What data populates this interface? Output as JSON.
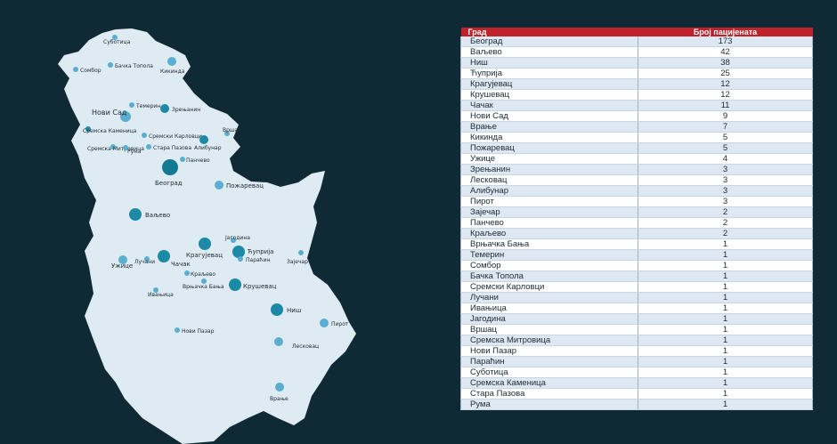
{
  "table": {
    "headers": {
      "city": "Град",
      "count": "Број пацијената"
    },
    "rows": [
      {
        "city": "Београд",
        "count": "173"
      },
      {
        "city": "Ваљево",
        "count": "42"
      },
      {
        "city": "Ниш",
        "count": "38"
      },
      {
        "city": "Ћуприја",
        "count": "25"
      },
      {
        "city": "Крагујевац",
        "count": "12"
      },
      {
        "city": "Крушевац",
        "count": "12"
      },
      {
        "city": "Чачак",
        "count": "11"
      },
      {
        "city": "Нови Сад",
        "count": "9"
      },
      {
        "city": "Врање",
        "count": "7"
      },
      {
        "city": "Кикинда",
        "count": "5"
      },
      {
        "city": "Пожаревац",
        "count": "5"
      },
      {
        "city": "Ужице",
        "count": "4"
      },
      {
        "city": "Зрењанин",
        "count": "3"
      },
      {
        "city": "Лесковац",
        "count": "3"
      },
      {
        "city": "Алибунар",
        "count": "3"
      },
      {
        "city": "Пирот",
        "count": "3"
      },
      {
        "city": "Зајечар",
        "count": "2"
      },
      {
        "city": "Панчево",
        "count": "2"
      },
      {
        "city": "Краљево",
        "count": "2"
      },
      {
        "city": "Врњачка Бања",
        "count": "1"
      },
      {
        "city": "Темерин",
        "count": "1"
      },
      {
        "city": "Сомбор",
        "count": "1"
      },
      {
        "city": "Бачка Топола",
        "count": "1"
      },
      {
        "city": "Сремски Карловци",
        "count": "1"
      },
      {
        "city": "Лучани",
        "count": "1"
      },
      {
        "city": "Ивањица",
        "count": "1"
      },
      {
        "city": "Јагодина",
        "count": "1"
      },
      {
        "city": "Вршац",
        "count": "1"
      },
      {
        "city": "Сремска Митровица",
        "count": "1"
      },
      {
        "city": "Нови Пазар",
        "count": "1"
      },
      {
        "city": "Параћин",
        "count": "1"
      },
      {
        "city": "Суботица",
        "count": "1"
      },
      {
        "city": "Сремска Каменица",
        "count": "1"
      },
      {
        "city": "Стара Пазова",
        "count": "1"
      },
      {
        "city": "Рума",
        "count": "1"
      }
    ]
  },
  "map": {
    "labels": {
      "subotica": "Суботица",
      "sombor": "Сомбор",
      "backa_topola": "Бачка Топола",
      "kikinda": "Кикинда",
      "temerin": "Темерин",
      "novi_sad": "Нови Сад",
      "zrenjanin": "Зрењанин",
      "sremska_kamenica": "Сремска Каменица",
      "sremski_karlovci": "Сремски Карловци",
      "vrsac": "Вршац",
      "sremska_mitrovica": "Сремска Митровица",
      "ruma": "Рума",
      "stara_pazova": "Стара Пазова",
      "alibunar": "Алибунар",
      "pancevo": "Панчево",
      "beograd": "Београд",
      "pozarevac": "Пожаревац",
      "valjevo": "Ваљево",
      "jagodina": "Јагодина",
      "kragujevac": "Крагујевац",
      "cuprija": "Ћуприја",
      "uzice": "Ужице",
      "lucani": "Лучани",
      "cacak": "Чачак",
      "paracin": "Параћин",
      "zajecar": "Зајечар",
      "kraljevo": "Краљево",
      "vrnjacka_banja": "Врњачка Бања",
      "krusevac": "Крушевац",
      "ivanjica": "Ивањица",
      "nis": "Ниш",
      "pirot": "Пирот",
      "novi_pazar": "Нови Пазар",
      "leskovac": "Лесковац",
      "vranje": "Врање"
    },
    "colors": {
      "background": "#0f2a35",
      "land": "#dfebf3",
      "bubble_light": "#5aaecf",
      "bubble_dark": "#1c8aa6",
      "bubble_darkest": "#127a93"
    }
  }
}
